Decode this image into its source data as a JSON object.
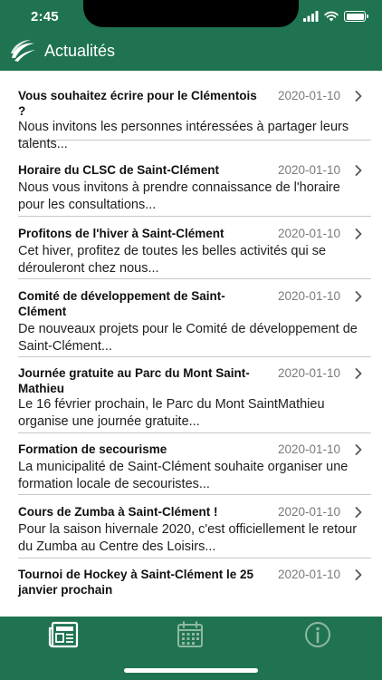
{
  "status": {
    "time": "2:45"
  },
  "header": {
    "title": "Actualités"
  },
  "news": [
    {
      "title": "Vous souhaitez écrire pour le Clémentois ?",
      "date": "2020-01-10",
      "excerpt": "Nous invitons les personnes intéressées à partager leurs talents..."
    },
    {
      "title": "Horaire du CLSC de Saint-Clément",
      "date": "2020-01-10",
      "excerpt": "Nous vous invitons à prendre connaissance de l'horaire pour les consultations..."
    },
    {
      "title": "Profitons de l'hiver à Saint-Clément",
      "date": "2020-01-10",
      "excerpt": "Cet hiver, profitez de toutes les belles activités qui se dérouleront chez nous..."
    },
    {
      "title": "Comité de développement de Saint-Clément",
      "date": "2020-01-10",
      "excerpt": "De nouveaux projets pour le Comité de développement de Saint-Clément..."
    },
    {
      "title": "Journée gratuite au Parc du Mont Saint-Mathieu",
      "date": "2020-01-10",
      "excerpt": "Le 16 février prochain, le Parc du Mont SaintMathieu organise une journée gratuite..."
    },
    {
      "title": "Formation de secourisme",
      "date": "2020-01-10",
      "excerpt": "La municipalité de Saint-Clément souhaite organiser une formation locale de secouristes..."
    },
    {
      "title": "Cours de Zumba à Saint-Clément !",
      "date": "2020-01-10",
      "excerpt": "Pour la saison hivernale 2020, c'est officiellement le retour du Zumba au Centre des Loisirs..."
    },
    {
      "title": "Tournoi de Hockey à Saint-Clément le 25 janvier prochain",
      "date": "2020-01-10",
      "excerpt": ""
    }
  ],
  "tabs": [
    {
      "name": "news",
      "icon": "newspaper-icon",
      "selected": true
    },
    {
      "name": "calendar",
      "icon": "calendar-icon",
      "selected": false
    },
    {
      "name": "info",
      "icon": "info-icon",
      "selected": false
    }
  ],
  "colors": {
    "brand_green": "#1f7350",
    "date_gray": "#7a7a7a",
    "divider": "#c8c8cc",
    "tab_inactive": "#8fb8a2"
  }
}
